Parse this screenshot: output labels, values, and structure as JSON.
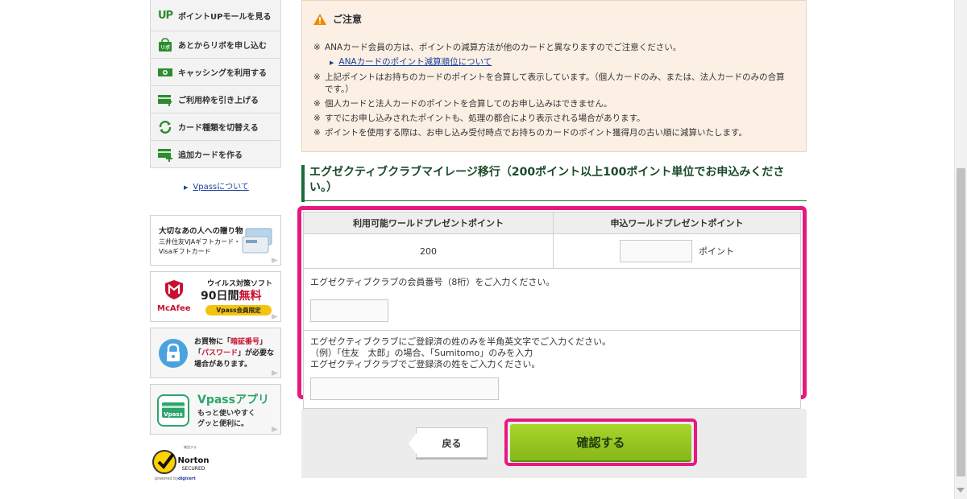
{
  "sidebar": {
    "items": [
      {
        "icon": "up-text-icon",
        "icon_text": "UP",
        "label": "ポイントUPモールを見る"
      },
      {
        "icon": "shopping-bag-icon",
        "icon_text": "リボ",
        "label": "あとからリボを申し込む"
      },
      {
        "icon": "cash-icon",
        "label": "キャッシングを利用する"
      },
      {
        "icon": "card-up-arrow-icon",
        "label": "ご利用枠を引き上げる"
      },
      {
        "icon": "switch-arrows-icon",
        "label": "カード種類を切替える"
      },
      {
        "icon": "card-plus-icon",
        "label": "追加カードを作る"
      }
    ],
    "vpass_link": "Vpassについて"
  },
  "banners": {
    "gift": {
      "line1": "大切なあの人への贈り物",
      "line2": "三井住友VJAギフトカード・",
      "line3": "Visaギフトカード"
    },
    "mcafee": {
      "brand": "McAfee",
      "line1": "ウイルス対策ソフト",
      "days": "90日間",
      "free": "無料",
      "badge": "Vpass会員限定"
    },
    "password": {
      "line1a": "お買物に「",
      "pin": "暗証番号",
      "line1b": "」",
      "line2a": "「",
      "pw": "パスワード",
      "line2b": "」が必要な",
      "line3": "場合があります。"
    },
    "app": {
      "title": "Vpassアプリ",
      "line1": "もっと使いやすく",
      "line2": "グッと便利に。",
      "icon_text": "Vpass"
    }
  },
  "norton": {
    "top": "確認する",
    "name": "Norton",
    "secured": "SECURED",
    "powered": "powered by",
    "digicert": "digicert"
  },
  "notice": {
    "title": "ご注意",
    "mark": "※",
    "items": [
      "ANAカード会員の方は、ポイントの減算方法が他のカードと異なりますのでご注意ください。",
      "上記ポイントはお持ちのカードのポイントを合算して表示しています。（個人カードのみ、または、法人カードのみの合算です。）",
      "個人カードと法人カードのポイントを合算してのお申し込みはできません。",
      "すでにお申し込みされたポイントも、処理の都合により表示される場合があります。",
      "ポイントを使用する際は、お申し込み受付時点でお持ちのカードのポイント獲得月の古い順に減算いたします。"
    ],
    "ana_link": "ANAカードのポイント減算順位について"
  },
  "section": {
    "title": "エグゼクティブクラブマイレージ移行（200ポイント以上100ポイント単位でお申込みください。）"
  },
  "table": {
    "col_available": "利用可能ワールドプレゼントポイント",
    "col_apply": "申込ワールドプレゼントポイント",
    "available_points": "200",
    "points_unit": "ポイント",
    "member_label": "エグゼクティブクラブの会員番号（8桁）をご入力ください。",
    "name_label_1": "エグゼクティブクラブにご登録済の姓のみを半角英文字でご入力ください。",
    "name_label_2": "（例）「住友　太郎」の場合、「Sumitomo」のみを入力",
    "name_label_3": "エグゼクティブクラブでご登録済の姓をご入力ください。"
  },
  "buttons": {
    "back": "戻る",
    "confirm": "確認する"
  },
  "colors": {
    "highlight": "#e6197e",
    "accent_green": "#1a6b3a",
    "confirm_green": "#96c81e",
    "notice_bg": "#fcefe4",
    "link_blue": "#1a3f9c"
  }
}
